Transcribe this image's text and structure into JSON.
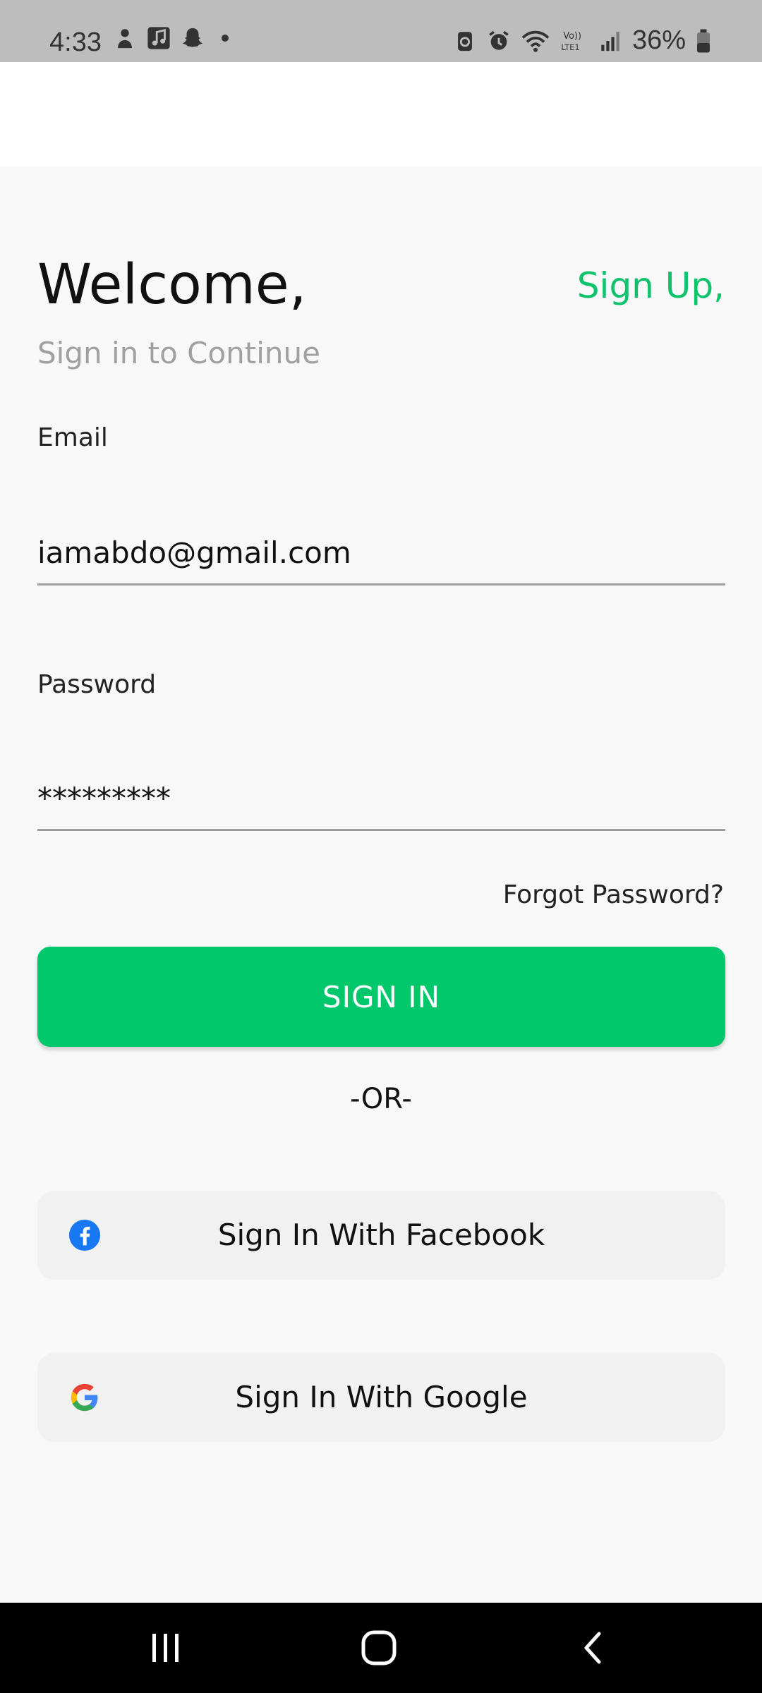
{
  "status_bar": {
    "time": "4:33",
    "battery": "36%",
    "left_icons": [
      "person-icon",
      "music-icon",
      "snapchat-icon",
      "dot-icon"
    ],
    "right_icons": [
      "battery-saver-icon",
      "alarm-icon",
      "wifi-icon",
      "volte-icon",
      "signal-icon",
      "battery-icon"
    ]
  },
  "login": {
    "welcome": "Welcome,",
    "signup": "Sign Up,",
    "subtitle": "Sign in to Continue",
    "email_label": "Email",
    "email_value": "iamabdo@gmail.com",
    "password_label": "Password",
    "password_value": "*********",
    "forgot": "Forgot Password?",
    "signin": "SIGN IN",
    "or": "-OR-",
    "facebook": "Sign In With Facebook",
    "google": "Sign In With Google"
  },
  "colors": {
    "accent": "#00c86a",
    "link": "#0fc36c",
    "facebook": "#1877f2"
  },
  "nav_bar": {
    "icons": [
      "recent-apps-icon",
      "home-icon",
      "back-icon"
    ]
  }
}
